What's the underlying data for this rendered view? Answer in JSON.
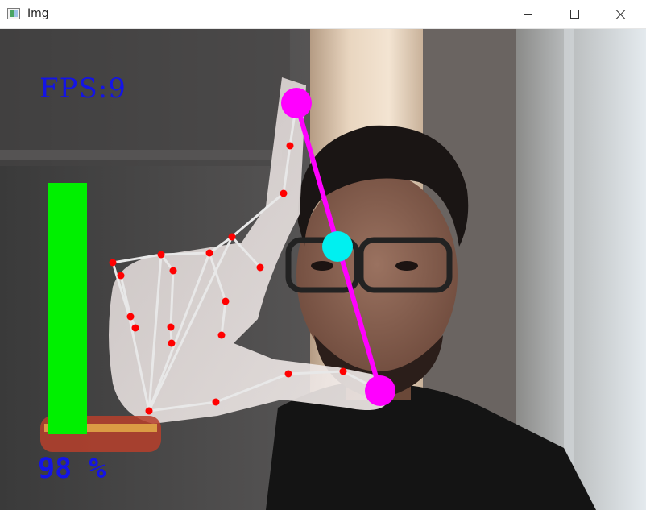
{
  "window": {
    "title": "Img",
    "controls": [
      "minimize",
      "maximize",
      "close"
    ]
  },
  "overlay": {
    "fps_label": "FPS:9",
    "volume_label": "98 %",
    "volume_fraction": 0.98
  },
  "colors": {
    "fps_text": "#1414e6",
    "volume_text": "#1414e6",
    "volume_bar": "#00f000",
    "landmark_points": "#ff0000",
    "hand_connections": "#e8e8e8",
    "finger_tips": "#ff00ff",
    "distance_line": "#ff00ff",
    "midpoint": "#00f0f0"
  },
  "icons": {
    "app": "opencv-window-icon",
    "minimize": "minimize-icon",
    "maximize": "maximize-icon",
    "close": "close-icon"
  }
}
